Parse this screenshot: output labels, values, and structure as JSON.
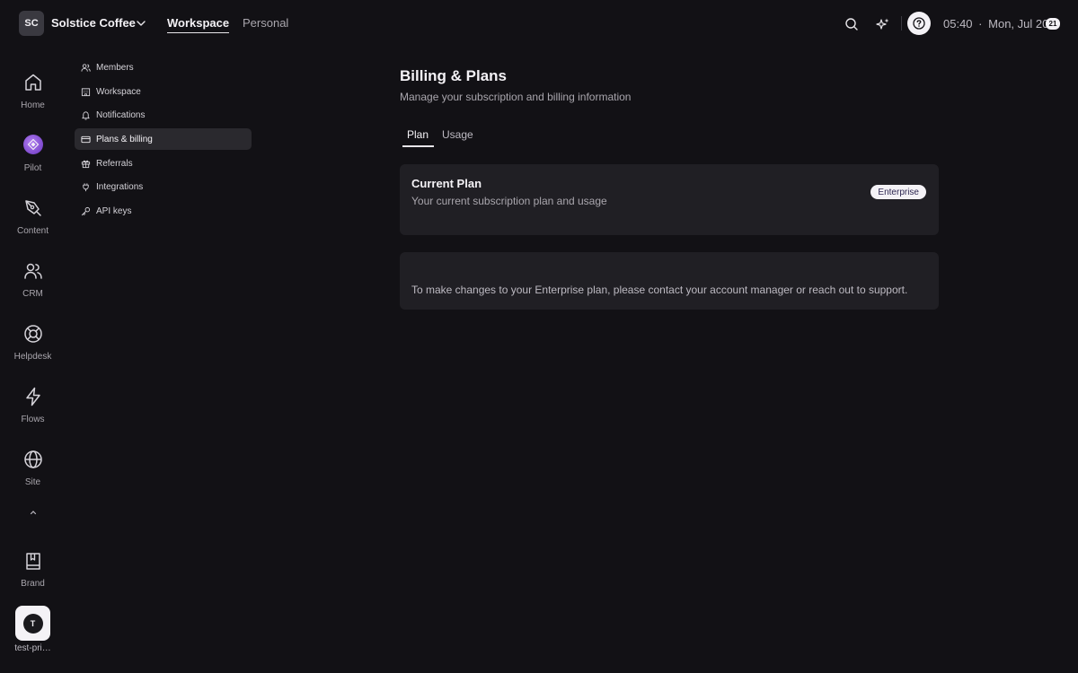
{
  "workspace": {
    "initials": "SC",
    "name": "Solstice Coffee"
  },
  "top_tabs": [
    "Workspace",
    "Personal"
  ],
  "clock": {
    "time": "05:40",
    "separator": "·",
    "date": "Mon, Jul 20",
    "day_badge": "21"
  },
  "rail": {
    "items": [
      {
        "label": "Home",
        "icon": "home-icon"
      },
      {
        "label": "Pilot",
        "icon": "pilot-icon"
      },
      {
        "label": "Content",
        "icon": "pen-icon"
      },
      {
        "label": "CRM",
        "icon": "users-icon"
      },
      {
        "label": "Helpdesk",
        "icon": "lifebuoy-icon"
      },
      {
        "label": "Flows",
        "icon": "lightning-icon"
      },
      {
        "label": "Site",
        "icon": "globe-icon"
      },
      {
        "label": "Brand",
        "icon": "book-icon"
      }
    ],
    "user": {
      "initial": "T",
      "name": "test-pri…"
    }
  },
  "settings_nav": {
    "items": [
      {
        "label": "Members",
        "icon": "members-icon"
      },
      {
        "label": "Workspace",
        "icon": "building-icon"
      },
      {
        "label": "Notifications",
        "icon": "bell-icon"
      },
      {
        "label": "Plans & billing",
        "icon": "credit-card-icon"
      },
      {
        "label": "Referrals",
        "icon": "gift-icon"
      },
      {
        "label": "Integrations",
        "icon": "plug-icon"
      },
      {
        "label": "API keys",
        "icon": "key-icon"
      }
    ],
    "active": "Plans & billing"
  },
  "main": {
    "title": "Billing & Plans",
    "subtitle": "Manage your subscription and billing information",
    "tabs": [
      "Plan",
      "Usage"
    ],
    "active_tab": "Plan",
    "current_plan": {
      "title": "Current Plan",
      "subtitle": "Your current subscription plan and usage",
      "badge": "Enterprise"
    },
    "note": "To make changes to your Enterprise plan, please contact your account manager or reach out to support."
  },
  "colors": {
    "background": "#121115",
    "card": "#201f24",
    "active_nav": "#2a292e",
    "accent": "#8a55d8"
  }
}
